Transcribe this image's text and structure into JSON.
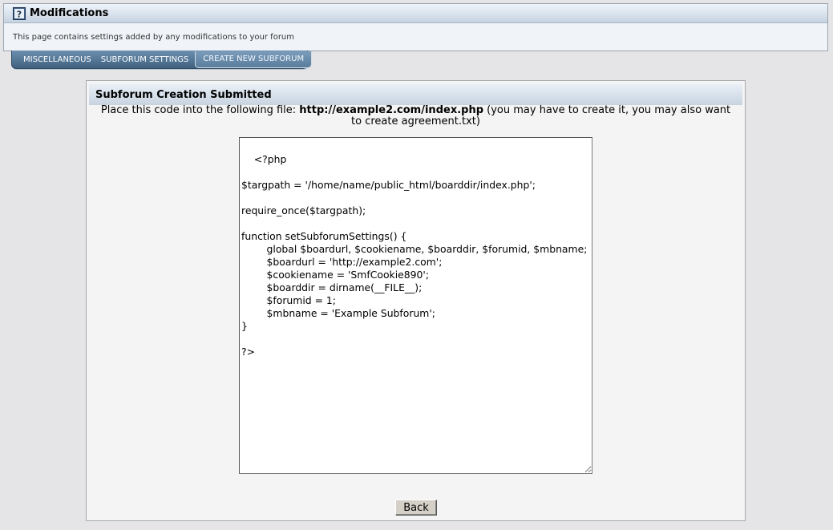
{
  "header": {
    "icon": "help-icon",
    "title": "Modifications",
    "description": "This page contains settings added by any modifications to your forum"
  },
  "tabs": [
    {
      "label": "MISCELLANEOUS",
      "active": false
    },
    {
      "label": "SUBFORUM SETTINGS",
      "active": false
    },
    {
      "label": "CREATE NEW SUBFORUM",
      "active": true
    }
  ],
  "result": {
    "title": "Subforum Creation Submitted",
    "instruction_prefix": "Place this code into the following file: ",
    "file_url": "http://example2.com/index.php",
    "instruction_suffix": " (you may have to create it, you may also want to create agreement.txt)",
    "code": "<?php\n\n$targpath = '/home/name/public_html/boarddir/index.php';\n\nrequire_once($targpath);\n\nfunction setSubforumSettings() {\n\tglobal $boardurl, $cookiename, $boarddir, $forumid, $mbname;\n\t$boardurl = 'http://example2.com';\n\t$cookiename = 'SmfCookie890';\n\t$boarddir = dirname(__FILE__);\n\t$forumid = 1;\n\t$mbname = 'Example Subforum';\n}\n\n?>",
    "back_label": "Back"
  },
  "colors": {
    "tab_bar": "#40627f",
    "page_background": "#e5e5e8"
  }
}
